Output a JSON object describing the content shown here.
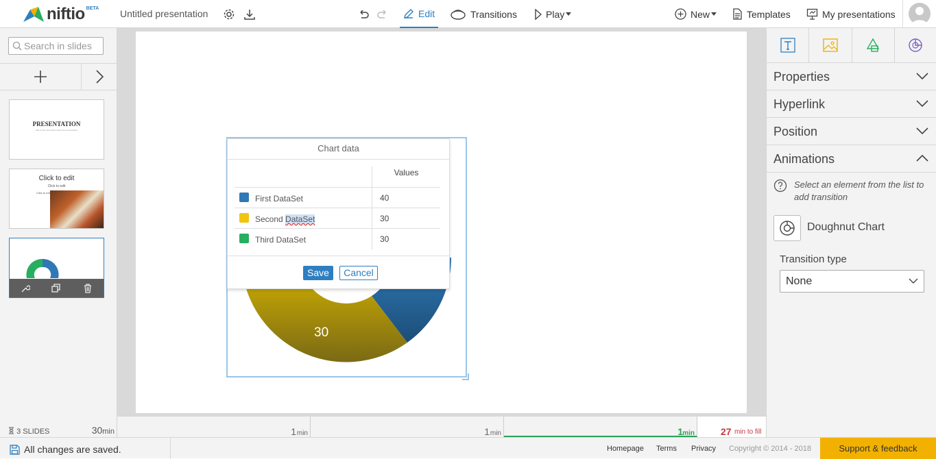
{
  "app": {
    "logo_text": "niftio",
    "logo_badge": "BETA",
    "doc_title": "Untitled presentation"
  },
  "toolbar": {
    "edit": "Edit",
    "transitions": "Transitions",
    "play": "Play",
    "new": "New",
    "templates": "Templates",
    "my_presentations": "My presentations"
  },
  "left": {
    "search_placeholder": "Search in slides",
    "slides": [
      {
        "title": "PRESENTATION",
        "subtitle": "Add a short description about the presentation"
      },
      {
        "title": "Click to edit",
        "subtitle": "Click to edit",
        "small": "Click to edit"
      },
      {
        "title": ""
      }
    ],
    "slides_count": "3 SLIDES",
    "total_value": "30",
    "total_unit": "min"
  },
  "canvas": {
    "donut_label": "30"
  },
  "chart_dialog": {
    "title": "Chart data",
    "values_header": "Values",
    "save": "Save",
    "cancel": "Cancel"
  },
  "chart_data": {
    "type": "doughnut",
    "series": [
      {
        "name": "First DataSet",
        "value": 40,
        "color": "#2f78b5"
      },
      {
        "name": "Second DataSet",
        "value": 30,
        "color": "#f1c40f"
      },
      {
        "name": "Third DataSet",
        "value": 30,
        "color": "#27ae60"
      }
    ]
  },
  "right": {
    "sections": {
      "properties": "Properties",
      "hyperlink": "Hyperlink",
      "position": "Position",
      "animations": "Animations"
    },
    "help_text": "Select an element from the list to add transition",
    "element_name": "Doughnut Chart",
    "transition_label": "Transition type",
    "transition_value": "None"
  },
  "timeline": {
    "segments": [
      {
        "value": "1",
        "unit": "min"
      },
      {
        "value": "1",
        "unit": "min"
      },
      {
        "value": "1",
        "unit": "min"
      }
    ],
    "remaining_value": "27",
    "remaining_unit": "min to fill"
  },
  "footer": {
    "saved": "All changes are saved.",
    "homepage": "Homepage",
    "terms": "Terms",
    "privacy": "Privacy",
    "copyright": "Copyright © 2014 - 2018",
    "support": "Support & feedback"
  }
}
